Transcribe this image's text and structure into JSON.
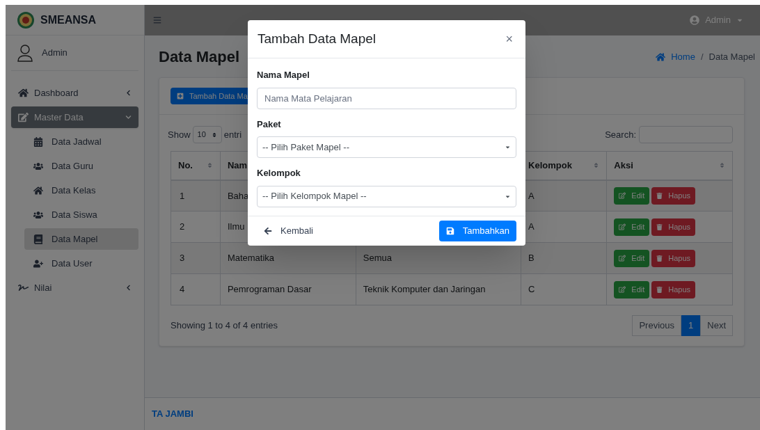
{
  "sidebar": {
    "brand": "SMEANSA",
    "user": "Admin",
    "items": [
      {
        "label": "Dashboard",
        "expanded": false,
        "selected": false,
        "has_caret": true
      },
      {
        "label": "Master Data",
        "expanded": true,
        "selected": true,
        "has_caret": true,
        "children": [
          {
            "label": "Data Jadwal",
            "selected": false
          },
          {
            "label": "Data Guru",
            "selected": false
          },
          {
            "label": "Data Kelas",
            "selected": false
          },
          {
            "label": "Data Siswa",
            "selected": false
          },
          {
            "label": "Data Mapel",
            "selected": true
          },
          {
            "label": "Data User",
            "selected": false
          }
        ]
      },
      {
        "label": "Nilai",
        "expanded": false,
        "selected": false,
        "has_caret": true
      }
    ]
  },
  "navbar": {
    "user": "Admin"
  },
  "page": {
    "title": "Data Mapel",
    "breadcrumb": [
      "Home",
      "Data Mapel"
    ],
    "breadcrumb_separator": "/",
    "add_button": "Tambah Data Ma",
    "length": {
      "show": "Show",
      "value": "10",
      "entries": "entri"
    },
    "search_label": "Search:",
    "table": {
      "columns": [
        {
          "label": "No.",
          "sortable": true
        },
        {
          "label": "Nam",
          "sortable": false
        },
        null,
        {
          "label": "Kelompok",
          "sortable": true
        },
        {
          "label": "Aksi",
          "sortable": true
        }
      ],
      "rows": [
        {
          "no": "1",
          "name": "Baha",
          "kelompok": "A",
          "edit": "Edit",
          "delete": "Hapus"
        },
        {
          "no": "2",
          "name": "Ilmu",
          "kelompok": "A",
          "edit": "Edit",
          "delete": "Hapus"
        },
        {
          "no": "3",
          "name": "Matematika",
          "column_3": "Semua",
          "kelompok": "B",
          "edit": "Edit",
          "delete": "Hapus"
        },
        {
          "no": "4",
          "name": "Pemrograman Dasar",
          "column_3": "Teknik Komputer dan Jaringan",
          "kelompok": "C",
          "edit": "Edit",
          "delete": "Hapus"
        }
      ]
    },
    "info": "Showing 1 to 4 of 4 entries",
    "pagination": [
      {
        "label": "Previous",
        "selected": false
      },
      {
        "label": "1",
        "selected": true
      },
      {
        "label": "Next",
        "selected": false
      }
    ]
  },
  "footer": "TA JAMBI",
  "modal": {
    "title": "Tambah Data Mapel",
    "close": "×",
    "fields": [
      {
        "kind": "input",
        "label": "Nama Mapel",
        "placeholder": "Nama Mata Pelajaran"
      },
      {
        "kind": "select",
        "label": "Paket",
        "value": "-- Pilih Paket Mapel --"
      },
      {
        "kind": "select",
        "label": "Kelompok",
        "value": "-- Pilih Kelompok Mapel --"
      }
    ],
    "back": "Kembali",
    "submit": "Tambahkan"
  }
}
